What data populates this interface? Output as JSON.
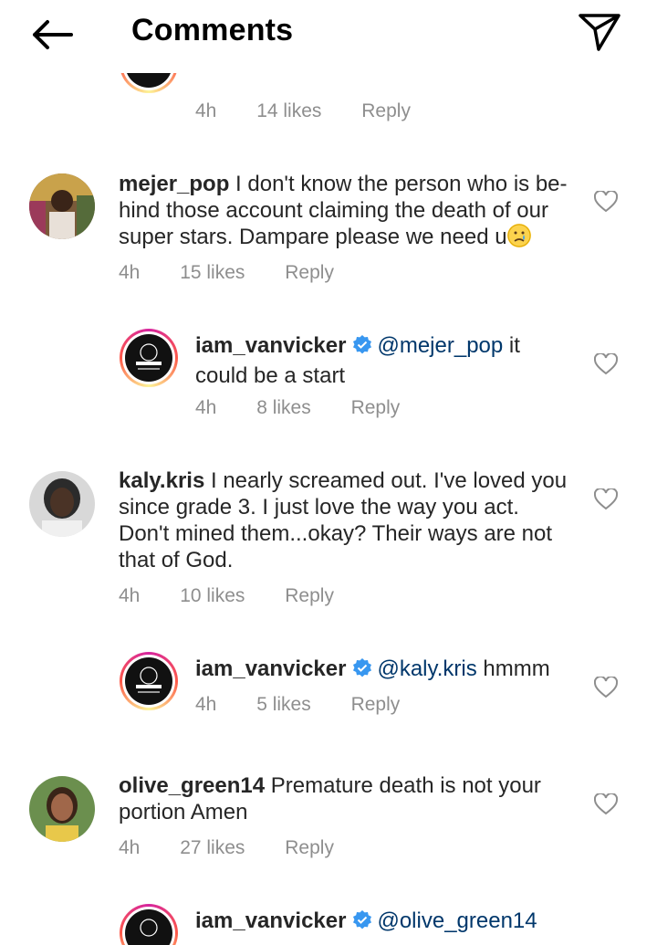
{
  "header": {
    "title": "Comments"
  },
  "comments": [
    {
      "time": "4h",
      "likes": "14 likes",
      "reply": "Reply"
    },
    {
      "username": "mejer_pop",
      "text": "I don't know the person who is be-",
      "text2": "hind those account claiming the death of our",
      "text3": "super stars.  Dampare please  we need u",
      "time": "4h",
      "likes": "15 likes",
      "reply": "Reply"
    },
    {
      "username": "iam_vanvicker",
      "mention": "@mejer_pop",
      "text": "it",
      "text2": "could be a start",
      "time": "4h",
      "likes": "8 likes",
      "reply": "Reply"
    },
    {
      "username": "kaly.kris",
      "text": "I nearly screamed out. I've loved you",
      "text2": "since grade 3. I just love the way you act.",
      "text3": "Don't mined them...okay? Their ways are not",
      "text4": "that of God.",
      "time": "4h",
      "likes": "10 likes",
      "reply": "Reply"
    },
    {
      "username": "iam_vanvicker",
      "mention": "@kaly.kris",
      "text": "hmmm",
      "time": "4h",
      "likes": "5 likes",
      "reply": "Reply"
    },
    {
      "username": "olive_green14",
      "text": "Premature death is not your",
      "text2": "portion Amen",
      "time": "4h",
      "likes": "27 likes",
      "reply": "Reply"
    },
    {
      "username": "iam_vanvicker",
      "mention": "@olive_green14"
    }
  ]
}
